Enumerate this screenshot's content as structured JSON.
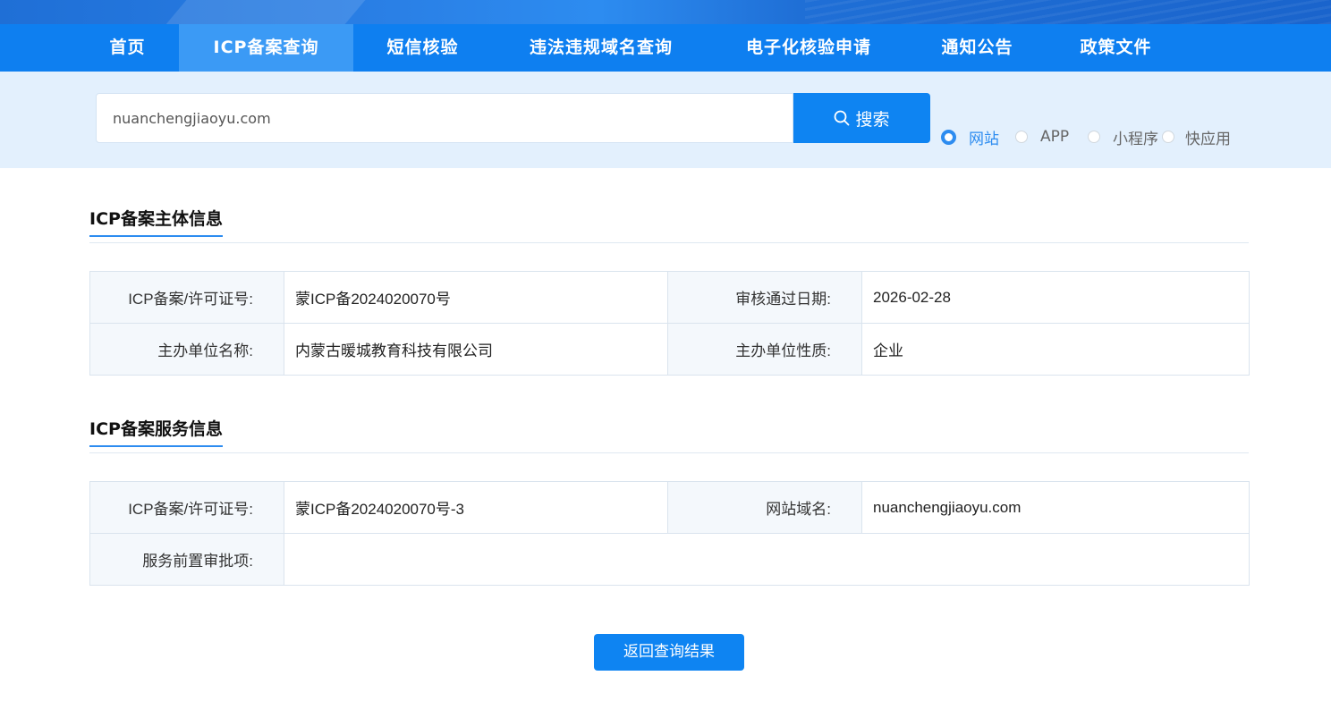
{
  "nav": {
    "items": [
      {
        "label": "首页"
      },
      {
        "label": "ICP备案查询"
      },
      {
        "label": "短信核验"
      },
      {
        "label": "违法违规域名查询"
      },
      {
        "label": "电子化核验申请"
      },
      {
        "label": "通知公告"
      },
      {
        "label": "政策文件"
      }
    ],
    "active": "ICP备案查询"
  },
  "search": {
    "value": "nuanchengjiaoyu.com",
    "button_label": "搜索",
    "button_icon": "search-icon",
    "types": [
      {
        "label": "网站",
        "checked": true
      },
      {
        "label": "APP",
        "checked": false
      },
      {
        "label": "小程序",
        "checked": false
      },
      {
        "label": "快应用",
        "checked": false
      }
    ]
  },
  "subject_info": {
    "title": "ICP备案主体信息",
    "rows": [
      {
        "label1": "ICP备案/许可证号:",
        "value1": "蒙ICP备2024020070号",
        "label2": "审核通过日期:",
        "value2": "2026-02-28"
      },
      {
        "label1": "主办单位名称:",
        "value1": "内蒙古暖城教育科技有限公司",
        "label2": "主办单位性质:",
        "value2": "企业"
      }
    ]
  },
  "service_info": {
    "title": "ICP备案服务信息",
    "license_label": "ICP备案/许可证号:",
    "license_value": "蒙ICP备2024020070号-3",
    "domain_label": "网站域名:",
    "domain_value": "nuanchengjiaoyu.com",
    "approval_label": "服务前置审批项:",
    "approval_value": ""
  },
  "back_button": {
    "label": "返回查询结果"
  },
  "colors": {
    "primary": "#0e84f2",
    "nav_bg": "#0e7ff0",
    "nav_active": "#3b9af5",
    "band_bg": "#e3f0fd"
  }
}
